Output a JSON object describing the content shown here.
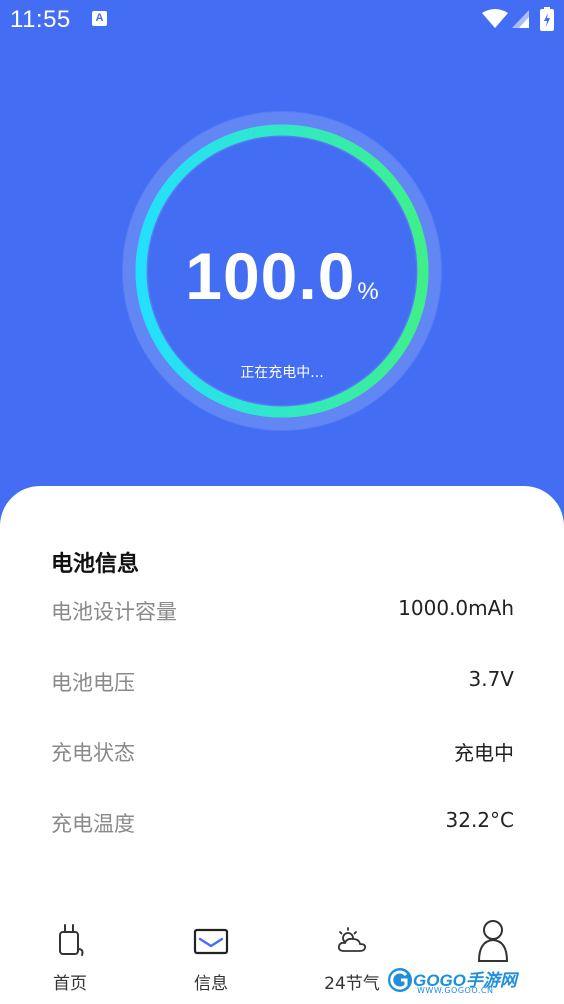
{
  "status_bar": {
    "time": "11:55",
    "notification_icon": "A"
  },
  "gauge": {
    "percent": 100.0,
    "value_text": "100.0",
    "unit": "%",
    "status": "正在充电中..."
  },
  "card": {
    "title": "电池信息",
    "rows": [
      {
        "label": "电池设计容量",
        "value": "1000.0mAh"
      },
      {
        "label": "电池电压",
        "value": "3.7V"
      },
      {
        "label": "充电状态",
        "value": "充电中"
      },
      {
        "label": "充电温度",
        "value": "32.2°C"
      }
    ]
  },
  "nav": {
    "items": [
      {
        "label": "首页",
        "icon": "charger-plug-icon"
      },
      {
        "label": "信息",
        "icon": "message-icon"
      },
      {
        "label": "24节气",
        "icon": "weather-cloud-icon"
      },
      {
        "label": "",
        "icon": "profile-icon"
      }
    ]
  },
  "watermark": {
    "text": "GOGO手游网",
    "sub": "WWW.GOGOO.CN"
  },
  "colors": {
    "background": "#436ef4",
    "gauge_start": "#23e0ff",
    "gauge_end": "#3ef08a",
    "card": "#ffffff"
  }
}
